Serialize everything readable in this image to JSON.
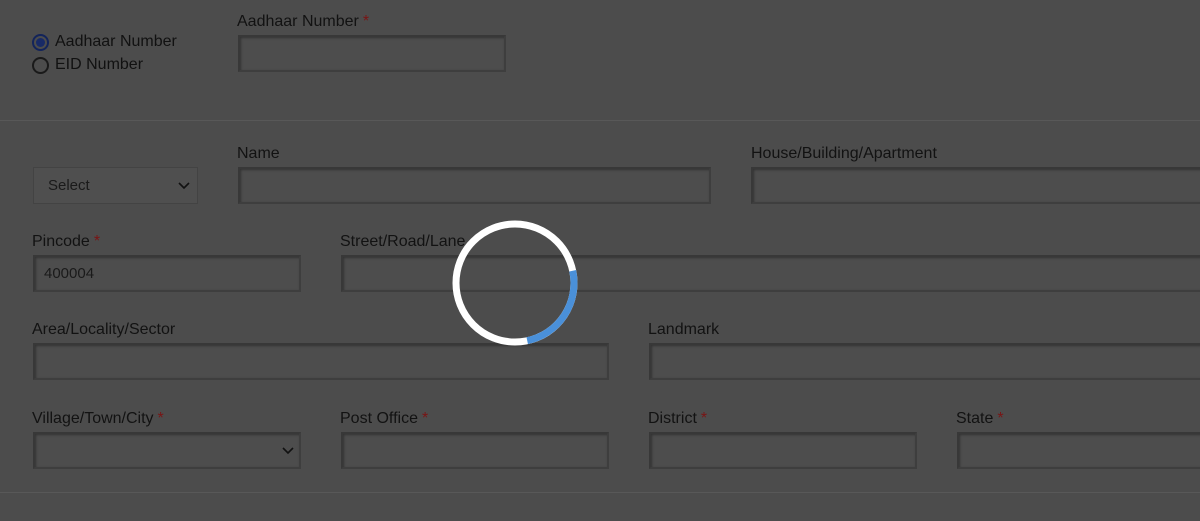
{
  "id_type": {
    "options": [
      "Aadhaar Number",
      "EID Number"
    ],
    "selected": "Aadhaar Number"
  },
  "aadhaar": {
    "label": "Aadhaar Number",
    "required_mark": "*",
    "value": ""
  },
  "salutation": {
    "value": "Select"
  },
  "name": {
    "label": "Name",
    "value": ""
  },
  "house": {
    "label": "House/Building/Apartment",
    "value": ""
  },
  "pincode": {
    "label": "Pincode",
    "required_mark": "*",
    "value": "400004"
  },
  "street": {
    "label": "Street/Road/Lane",
    "value": ""
  },
  "area": {
    "label": "Area/Locality/Sector",
    "value": ""
  },
  "landmark": {
    "label": "Landmark",
    "value": ""
  },
  "village": {
    "label": "Village/Town/City",
    "required_mark": "*",
    "value": ""
  },
  "post_office": {
    "label": "Post Office",
    "required_mark": "*",
    "value": ""
  },
  "district": {
    "label": "District",
    "required_mark": "*",
    "value": ""
  },
  "state": {
    "label": "State",
    "required_mark": "*",
    "value": ""
  },
  "loading": {
    "progress_fraction": 0.25,
    "colors": {
      "track": "#ffffff",
      "progress": "#4a90d9",
      "overlay": "#4c4c4c"
    }
  }
}
